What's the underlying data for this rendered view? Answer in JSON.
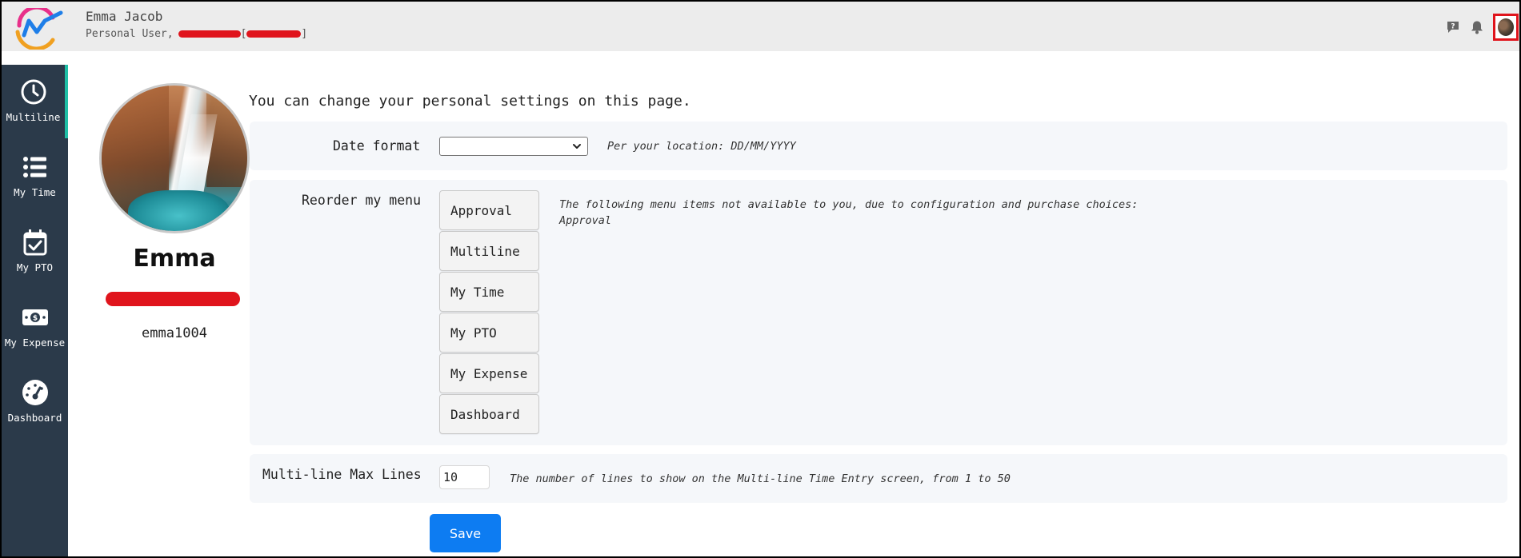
{
  "header": {
    "user_name": "Emma Jacob",
    "user_role_prefix": "Personal User,",
    "bracket_open": "[",
    "bracket_close": "]"
  },
  "sidebar": {
    "items": [
      {
        "label": "Multiline",
        "icon": "clock-icon",
        "active": true
      },
      {
        "label": "My Time",
        "icon": "list-icon",
        "active": false
      },
      {
        "label": "My PTO",
        "icon": "calendar-check-icon",
        "active": false
      },
      {
        "label": "My Expense",
        "icon": "money-icon",
        "active": false
      },
      {
        "label": "Dashboard",
        "icon": "gauge-icon",
        "active": false
      }
    ]
  },
  "profile": {
    "first_name": "Emma",
    "username": "emma1004"
  },
  "main": {
    "intro": "You can change your personal settings on this page.",
    "date_format": {
      "label": "Date format",
      "value": "",
      "hint": "Per your location: DD/MM/YYYY"
    },
    "reorder": {
      "label": "Reorder my menu",
      "items": [
        "Approval",
        "Multiline",
        "My Time",
        "My PTO",
        "My Expense",
        "Dashboard"
      ],
      "notice_line1": "The following menu items not available to you, due to configuration and purchase choices:",
      "notice_line2": "Approval"
    },
    "max_lines": {
      "label": "Multi-line Max Lines",
      "value": "10",
      "hint": "The number of lines to show on the Multi-line Time Entry screen, from 1 to 50"
    },
    "save_label": "Save"
  },
  "colors": {
    "sidebar_bg": "#2b3a4a",
    "active_accent": "#1fbfa6",
    "save_button": "#0d7cf2",
    "redaction": "#e0141c",
    "topbar_bg": "#ececec"
  }
}
